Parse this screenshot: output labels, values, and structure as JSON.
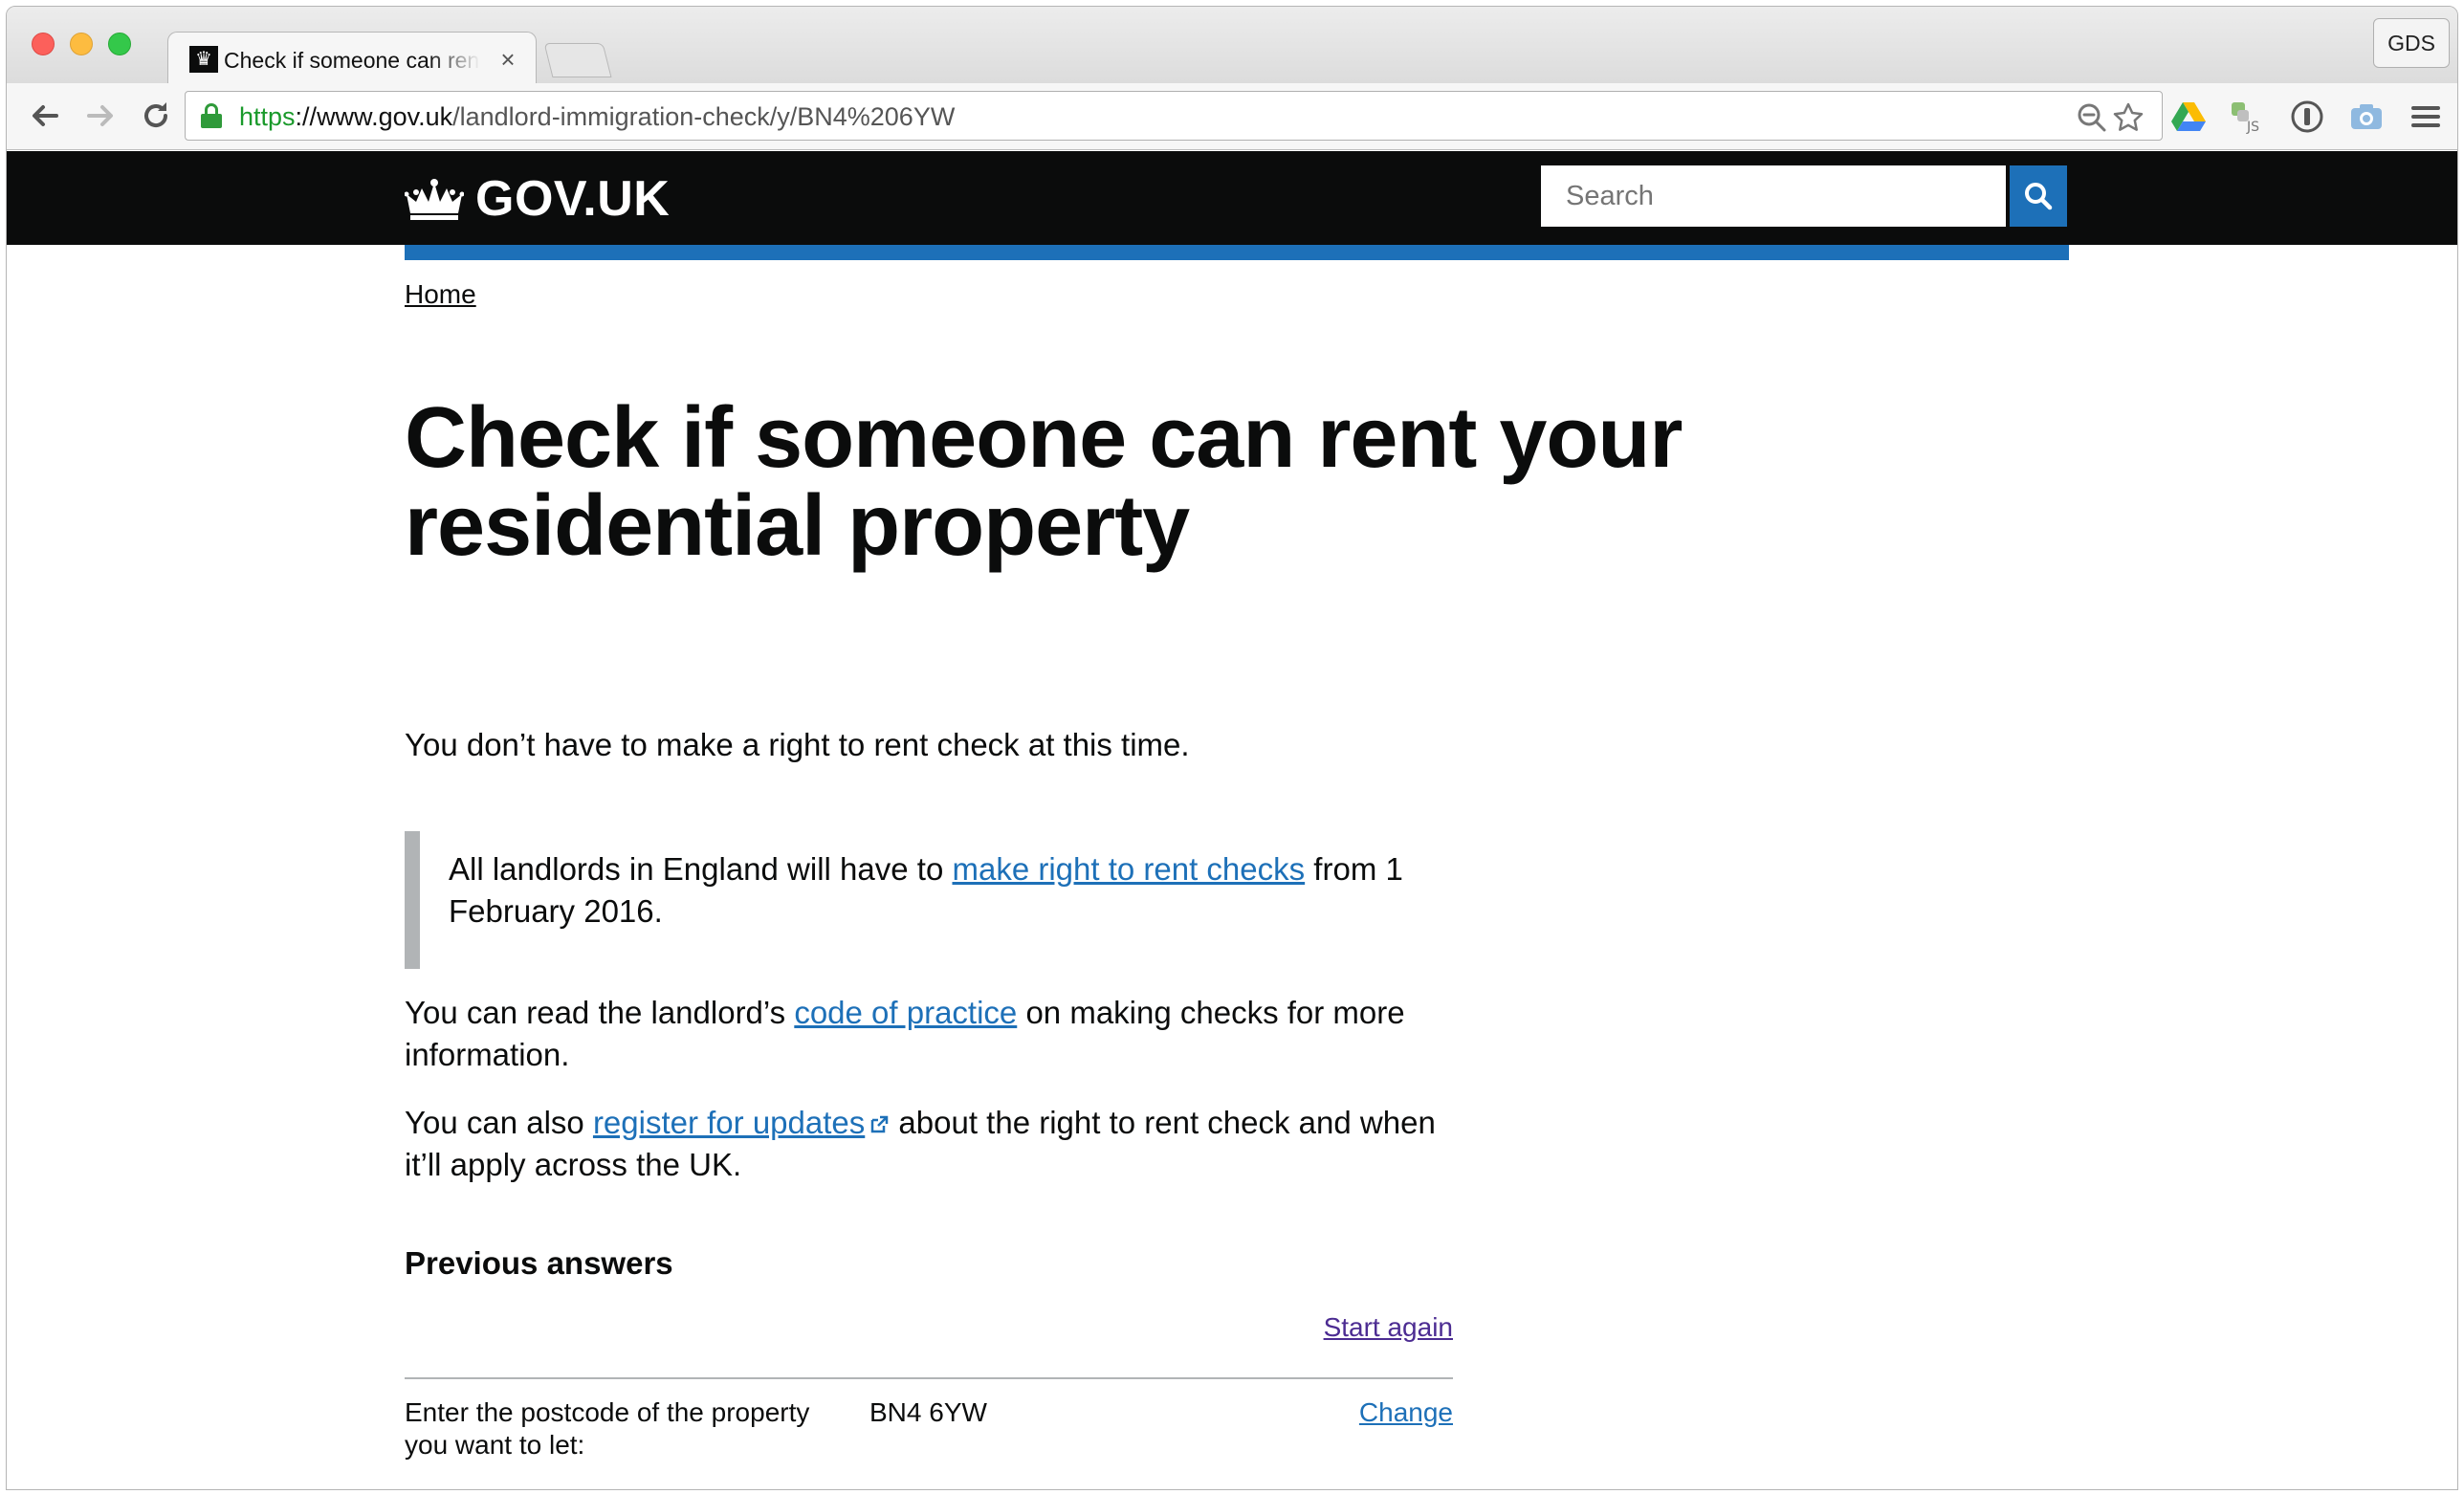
{
  "browser": {
    "tab_title": "Check if someone can rent your residential property",
    "tab_close": "×",
    "profile_label": "GDS",
    "url": {
      "scheme": "https",
      "sep": "://",
      "host": "www.gov.uk",
      "path": "/landlord-immigration-check/y/BN4%206YW"
    },
    "icons": {
      "back": "back-arrow-icon",
      "forward": "forward-arrow-icon",
      "reload": "reload-icon",
      "zoom": "zoom-out-icon",
      "bookmark": "star-icon",
      "ext_drive": "google-drive-icon",
      "ext_js": "js-extension-icon",
      "ext_password": "password-manager-icon",
      "ext_camera": "camera-icon",
      "menu": "hamburger-menu-icon"
    }
  },
  "header": {
    "logo_text": "GOV.UK",
    "search_placeholder": "Search",
    "search_button_label": "Search"
  },
  "breadcrumb": {
    "home": "Home"
  },
  "main": {
    "title": "Check if someone can rent your residential property",
    "intro": "You don’t have to make a right to rent check at this time.",
    "inset": {
      "before": "All landlords in England will have to ",
      "link": "make right to rent checks",
      "after": " from 1 February 2016."
    },
    "para1": {
      "before": "You can read the landlord’s ",
      "link": "code of practice",
      "after": " on making checks for more information."
    },
    "para2": {
      "before": "You can also ",
      "link": "register for updates",
      "after": " about the right to rent check and when it’ll apply across the UK."
    }
  },
  "previous_answers": {
    "heading": "Previous answers",
    "start_again": "Start again",
    "rows": [
      {
        "question": "Enter the postcode of the property you want to let:",
        "answer": "BN4 6YW",
        "change": "Change"
      }
    ]
  },
  "colors": {
    "header_bg": "#0b0c0c",
    "brand_blue": "#1d70b8",
    "link": "#1d70b8",
    "visited_link": "#4c2c92",
    "inset_border": "#b1b4b6",
    "secure_green": "#1a9a2b"
  }
}
